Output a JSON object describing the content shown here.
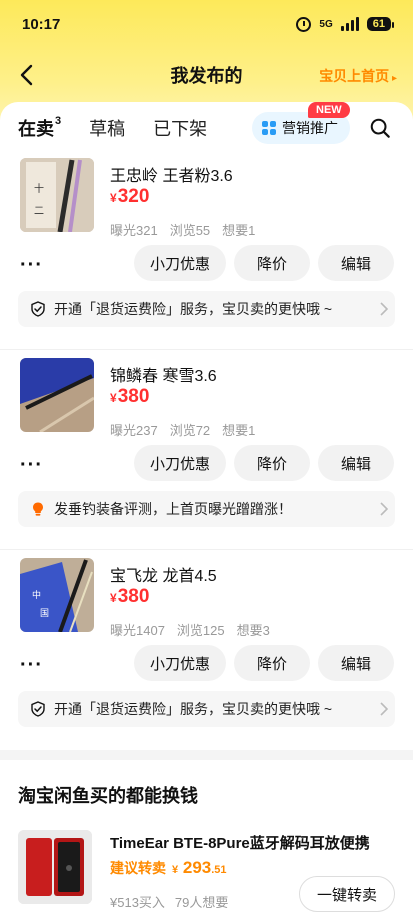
{
  "status": {
    "time": "10:17",
    "network": "5G",
    "battery": "61"
  },
  "nav": {
    "title": "我发布的",
    "right_link": "宝贝上首页"
  },
  "tabs": [
    {
      "label": "在卖",
      "count": "3"
    },
    {
      "label": "草稿"
    },
    {
      "label": "已下架"
    }
  ],
  "promo": {
    "label": "营销推广",
    "badge": "NEW"
  },
  "actions": {
    "cut": "小刀优惠",
    "drop": "降价",
    "edit": "编辑",
    "more": "···"
  },
  "items": [
    {
      "title": "王忠岭 王者粉3.6",
      "currency": "¥",
      "price": "320",
      "exposure": "曝光321",
      "views": "浏览55",
      "wants": "想要1",
      "tip": "开通「退货运费险」服务，宝贝卖的更快哦 ~",
      "tip_icon": "shield-check-icon"
    },
    {
      "title": "锦鳞春 寒雪3.6",
      "currency": "¥",
      "price": "380",
      "exposure": "曝光237",
      "views": "浏览72",
      "wants": "想要1",
      "tip": "发垂钓装备评测，上首页曝光蹭蹭涨！",
      "tip_icon": "bulb-icon"
    },
    {
      "title": "宝飞龙 龙首4.5",
      "currency": "¥",
      "price": "380",
      "exposure": "曝光1407",
      "views": "浏览125",
      "wants": "想要3",
      "tip": "开通「退货运费险」服务，宝贝卖的更快哦 ~",
      "tip_icon": "shield-check-icon"
    }
  ],
  "recommend": {
    "section_title": "淘宝闲鱼买的都能换钱",
    "title": "TimeEar BTE-8Pure蓝牙解码耳放便携",
    "tag": "建议转卖",
    "currency": "¥",
    "price_int": "293",
    "price_dec": ".51",
    "bought": "¥513买入",
    "wants": "79人想要",
    "button": "一键转卖"
  },
  "colors": {
    "accent_yellow": "#fde95a",
    "price_red": "#ff3030",
    "orange": "#ff8a00",
    "badge_red": "#ff3b44"
  }
}
